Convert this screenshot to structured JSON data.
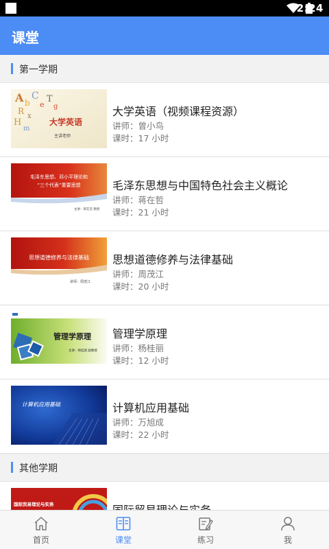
{
  "status_bar": {
    "time": "2:24"
  },
  "app_bar": {
    "title": "课堂"
  },
  "sections": [
    {
      "title": "第一学期",
      "courses": [
        {
          "title": "大学英语（视频课程资源）",
          "teacher": "讲师：曾小鸟",
          "hours": "课时：17 小时"
        },
        {
          "title": "毛泽东思想与中国特色社会主义概论",
          "teacher": "讲师：蒋在哲",
          "hours": "课时：21 小时"
        },
        {
          "title": "思想道德修养与法律基础",
          "teacher": "讲师：周茂江",
          "hours": "课时：20 小时"
        },
        {
          "title": "管理学原理",
          "teacher": "讲师：杨桂丽",
          "hours": "课时：12 小时"
        },
        {
          "title": "计算机应用基础",
          "teacher": "讲师：万旭成",
          "hours": "课时：22 小时"
        }
      ]
    },
    {
      "title": "其他学期",
      "courses": [
        {
          "title": "国际贸易理论与实务"
        }
      ]
    }
  ],
  "thumbnails": {
    "english": {
      "title": "大学英语",
      "sub": "主讲老师"
    },
    "maozedong": {
      "line1": "毛泽东思想、邓小平理论和",
      "line2": "“三个代表”重要思想",
      "sub": "主讲：蒋在哲 教授"
    },
    "sixiang": {
      "title": "思想道德修养与法律基础",
      "sub": "讲师：周茂江"
    },
    "guanli": {
      "title": "管理学原理",
      "sub": "主讲：杨桂丽 副教授"
    },
    "computer": {
      "title": "计算机应用基础"
    },
    "trade": {
      "title": "国际贸易理论与实务"
    }
  },
  "bottom_nav": [
    {
      "label": "首页",
      "icon": "home-icon",
      "active": false
    },
    {
      "label": "课堂",
      "icon": "book-icon",
      "active": true
    },
    {
      "label": "练习",
      "icon": "edit-icon",
      "active": false
    },
    {
      "label": "我",
      "icon": "user-icon",
      "active": false
    }
  ],
  "colors": {
    "primary": "#4b8cf5",
    "section_bg": "#f2f2f2"
  }
}
